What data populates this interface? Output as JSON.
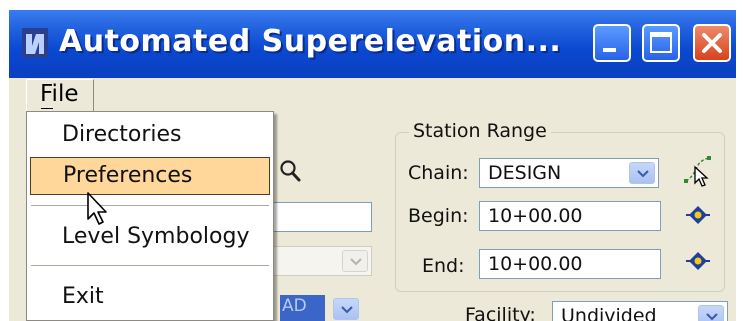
{
  "window": {
    "title": "Automated Superelevation..."
  },
  "menubar": {
    "file_label": "File"
  },
  "file_menu": {
    "items": [
      {
        "label": "Directories"
      },
      {
        "label": "Preferences",
        "selected": true
      },
      {
        "label": "Level Symbology"
      },
      {
        "label": "Exit"
      }
    ],
    "highlight_color": "#ffd79a"
  },
  "station_range": {
    "title": "Station Range",
    "chain_label": "Chain:",
    "chain_value": "DESIGN",
    "begin_label": "Begin:",
    "begin_value": "10+00.00",
    "end_label": "End:",
    "end_value": "10+00.00"
  },
  "lower": {
    "partial_text": "AD",
    "facility_label": "Facility:",
    "facility_value": "Undivided"
  },
  "icons": {
    "app": "app-icon",
    "search": "magnifier-icon",
    "select_chain": "select-chain-icon",
    "locate_begin": "locate-target-icon",
    "locate_end": "locate-target-icon"
  },
  "colors": {
    "titlebar": "#0a48d0",
    "close_button": "#d6431c",
    "dialog_bg": "#ece9d8"
  }
}
